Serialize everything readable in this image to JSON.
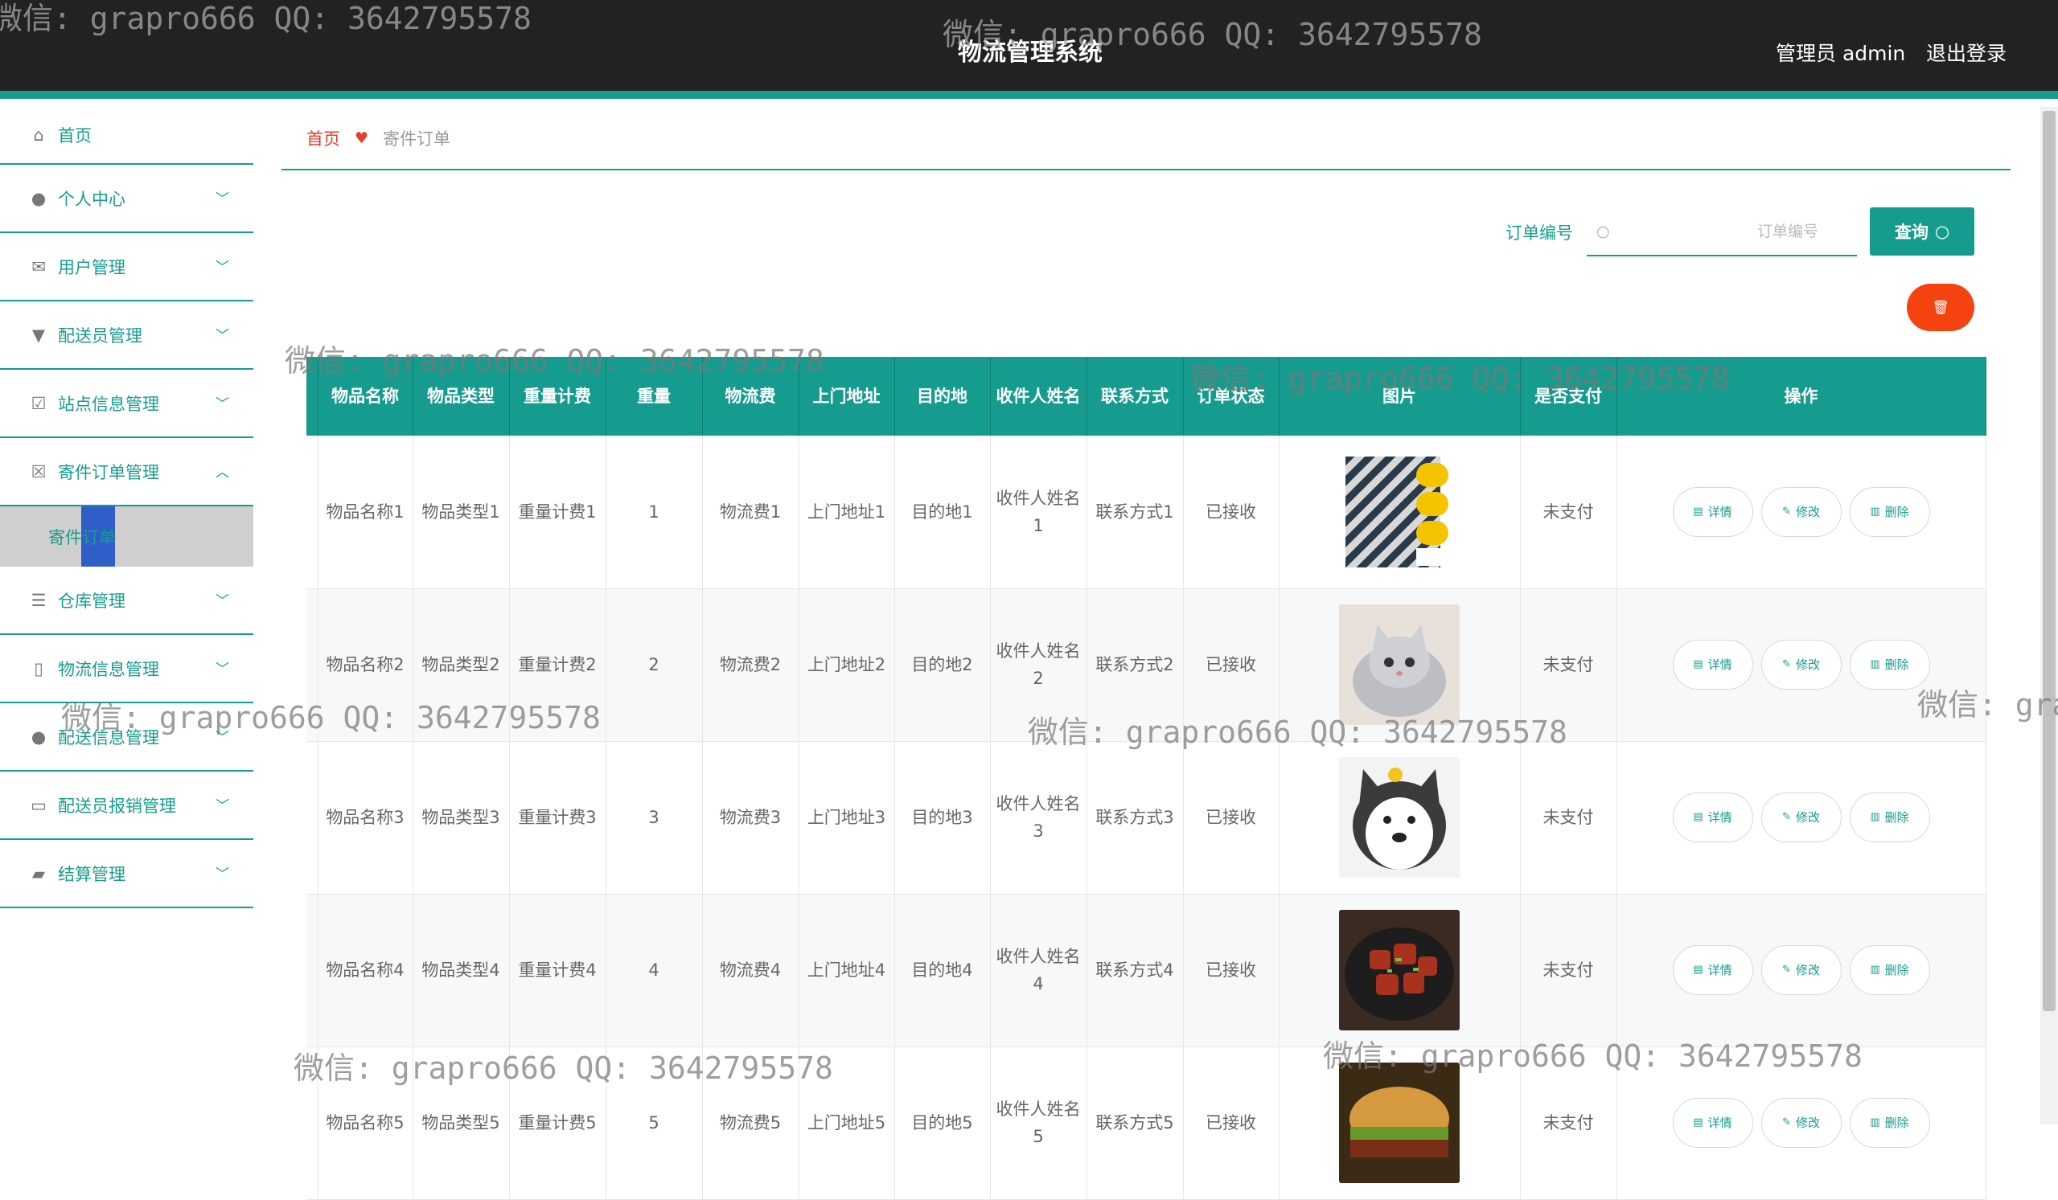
{
  "header": {
    "title": "物流管理系统",
    "admin": "管理员 admin",
    "logout": "退出登录"
  },
  "sidebar": {
    "items": [
      {
        "label": "首页",
        "icon": "home-icon"
      },
      {
        "label": "个人中心",
        "icon": "user-icon"
      },
      {
        "label": "用户管理",
        "icon": "mail-icon"
      },
      {
        "label": "配送员管理",
        "icon": "shield-icon"
      },
      {
        "label": "站点信息管理",
        "icon": "chart-icon"
      },
      {
        "label": "寄件订单管理",
        "icon": "clipboard-icon"
      },
      {
        "label": "寄件订单",
        "icon": ""
      },
      {
        "label": "仓库管理",
        "icon": "list-icon"
      },
      {
        "label": "物流信息管理",
        "icon": "phone-icon"
      },
      {
        "label": "配送信息管理",
        "icon": "user-icon"
      },
      {
        "label": "配送员报销管理",
        "icon": "message-icon"
      },
      {
        "label": "结算管理",
        "icon": "wallet-icon"
      }
    ]
  },
  "breadcrumb": {
    "home": "首页",
    "current": "寄件订单"
  },
  "search": {
    "label": "订单编号",
    "placeholder": "订单编号",
    "button": "查询"
  },
  "table": {
    "headers": [
      "物品名称",
      "物品类型",
      "重量计费",
      "重量",
      "物流费",
      "上门地址",
      "目的地",
      "收件人姓名",
      "联系方式",
      "订单状态",
      "图片",
      "是否支付",
      "操作"
    ],
    "actions": {
      "detail": "详情",
      "edit": "修改",
      "delete": "删除"
    },
    "rows": [
      {
        "name": "物品名称1",
        "type": "物品类型1",
        "weight_fee": "重量计费1",
        "weight": "1",
        "fee": "物流费1",
        "address": "上门地址1",
        "dest": "目的地1",
        "receiver": "收件人姓名1",
        "contact": "联系方式1",
        "status": "已接收",
        "image": "book-cover",
        "paid": "未支付"
      },
      {
        "name": "物品名称2",
        "type": "物品类型2",
        "weight_fee": "重量计费2",
        "weight": "2",
        "fee": "物流费2",
        "address": "上门地址2",
        "dest": "目的地2",
        "receiver": "收件人姓名2",
        "contact": "联系方式2",
        "status": "已接收",
        "image": "kitten-photo",
        "paid": "未支付"
      },
      {
        "name": "物品名称3",
        "type": "物品类型3",
        "weight_fee": "重量计费3",
        "weight": "3",
        "fee": "物流费3",
        "address": "上门地址3",
        "dest": "目的地3",
        "receiver": "收件人姓名3",
        "contact": "联系方式3",
        "status": "已接收",
        "image": "dog-photo",
        "paid": "未支付"
      },
      {
        "name": "物品名称4",
        "type": "物品类型4",
        "weight_fee": "重量计费4",
        "weight": "4",
        "fee": "物流费4",
        "address": "上门地址4",
        "dest": "目的地4",
        "receiver": "收件人姓名4",
        "contact": "联系方式4",
        "status": "已接收",
        "image": "braised-pork-photo",
        "paid": "未支付"
      },
      {
        "name": "物品名称5",
        "type": "物品类型5",
        "weight_fee": "重量计费5",
        "weight": "5",
        "fee": "物流费5",
        "address": "上门地址5",
        "dest": "目的地5",
        "receiver": "收件人姓名5",
        "contact": "联系方式5",
        "status": "已接收",
        "image": "burger-photo",
        "paid": "未支付"
      }
    ]
  },
  "watermark": "微信: grapro666 QQ: 3642795578",
  "colors": {
    "accent": "#169c8e",
    "header_bg": "#222222",
    "danger": "#f4430e",
    "breadcrumb": "#e73e2d"
  }
}
